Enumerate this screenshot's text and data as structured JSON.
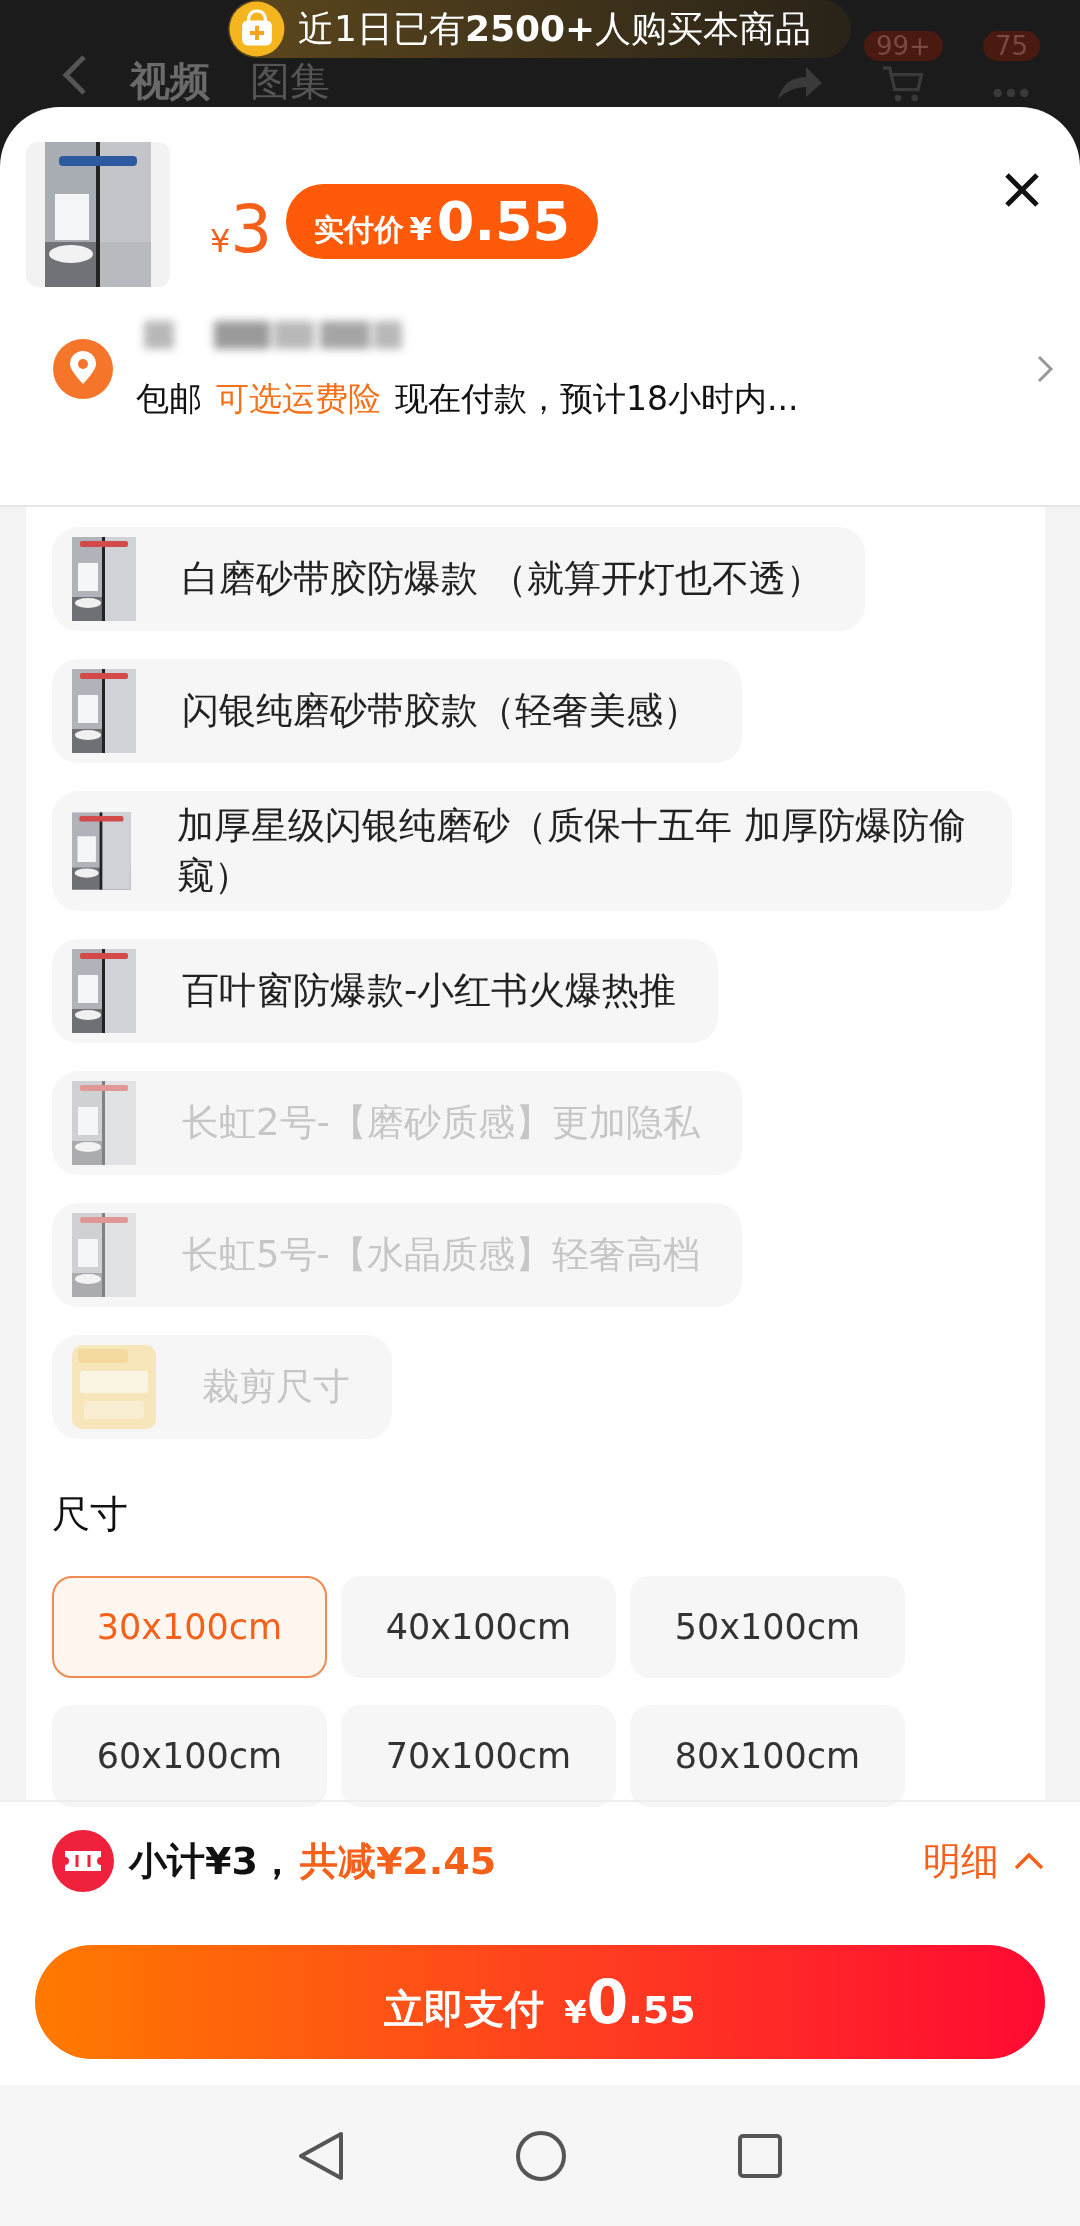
{
  "background_header": {
    "tabs": [
      {
        "label": "视频",
        "selected": true
      },
      {
        "label": "图集",
        "selected": false
      }
    ],
    "cart_badge": "99+",
    "message_badge": "75"
  },
  "banner": {
    "text": "近1日已有**2500+**人购买本商品"
  },
  "product": {
    "price_currency": "¥",
    "price": "3",
    "final_price_label": "实付价",
    "final_price_currency": "¥",
    "final_price": "0.55"
  },
  "delivery": {
    "shipping": "包邮",
    "insurance_link": "可选运费险",
    "eta": "现在付款，预计18小时内..."
  },
  "options": [
    {
      "label": "白磨砂带胶防爆款 （就算开灯也不透）",
      "disabled": false,
      "selected": false
    },
    {
      "label": "闪银纯磨砂带胶款（轻奢美感）",
      "disabled": false,
      "selected": false
    },
    {
      "label": "加厚星级闪银纯磨砂（质保十五年 加厚防爆防偷窥）",
      "disabled": false,
      "selected": false
    },
    {
      "label": "百叶窗防爆款-小红书火爆热推",
      "disabled": false,
      "selected": false
    },
    {
      "label": "长虹2号-【磨砂质感】更加隐私",
      "disabled": true,
      "selected": false
    },
    {
      "label": "长虹5号-【水晶质感】轻奢高档",
      "disabled": true,
      "selected": false
    },
    {
      "label": "裁剪尺寸",
      "disabled": true,
      "selected": false
    }
  ],
  "size_section": {
    "title": "尺寸",
    "sizes": [
      {
        "label": "30x100cm",
        "selected": true
      },
      {
        "label": "40x100cm",
        "selected": false
      },
      {
        "label": "50x100cm",
        "selected": false
      },
      {
        "label": "60x100cm",
        "selected": false
      },
      {
        "label": "70x100cm",
        "selected": false
      },
      {
        "label": "80x100cm",
        "selected": false
      }
    ]
  },
  "summary": {
    "subtotal": "小计¥3，",
    "discount": "共减¥2.45",
    "details_link": "明细"
  },
  "pay_button": {
    "label": "立即支付",
    "currency": "¥",
    "integer": "0",
    "decimal": ".55"
  }
}
